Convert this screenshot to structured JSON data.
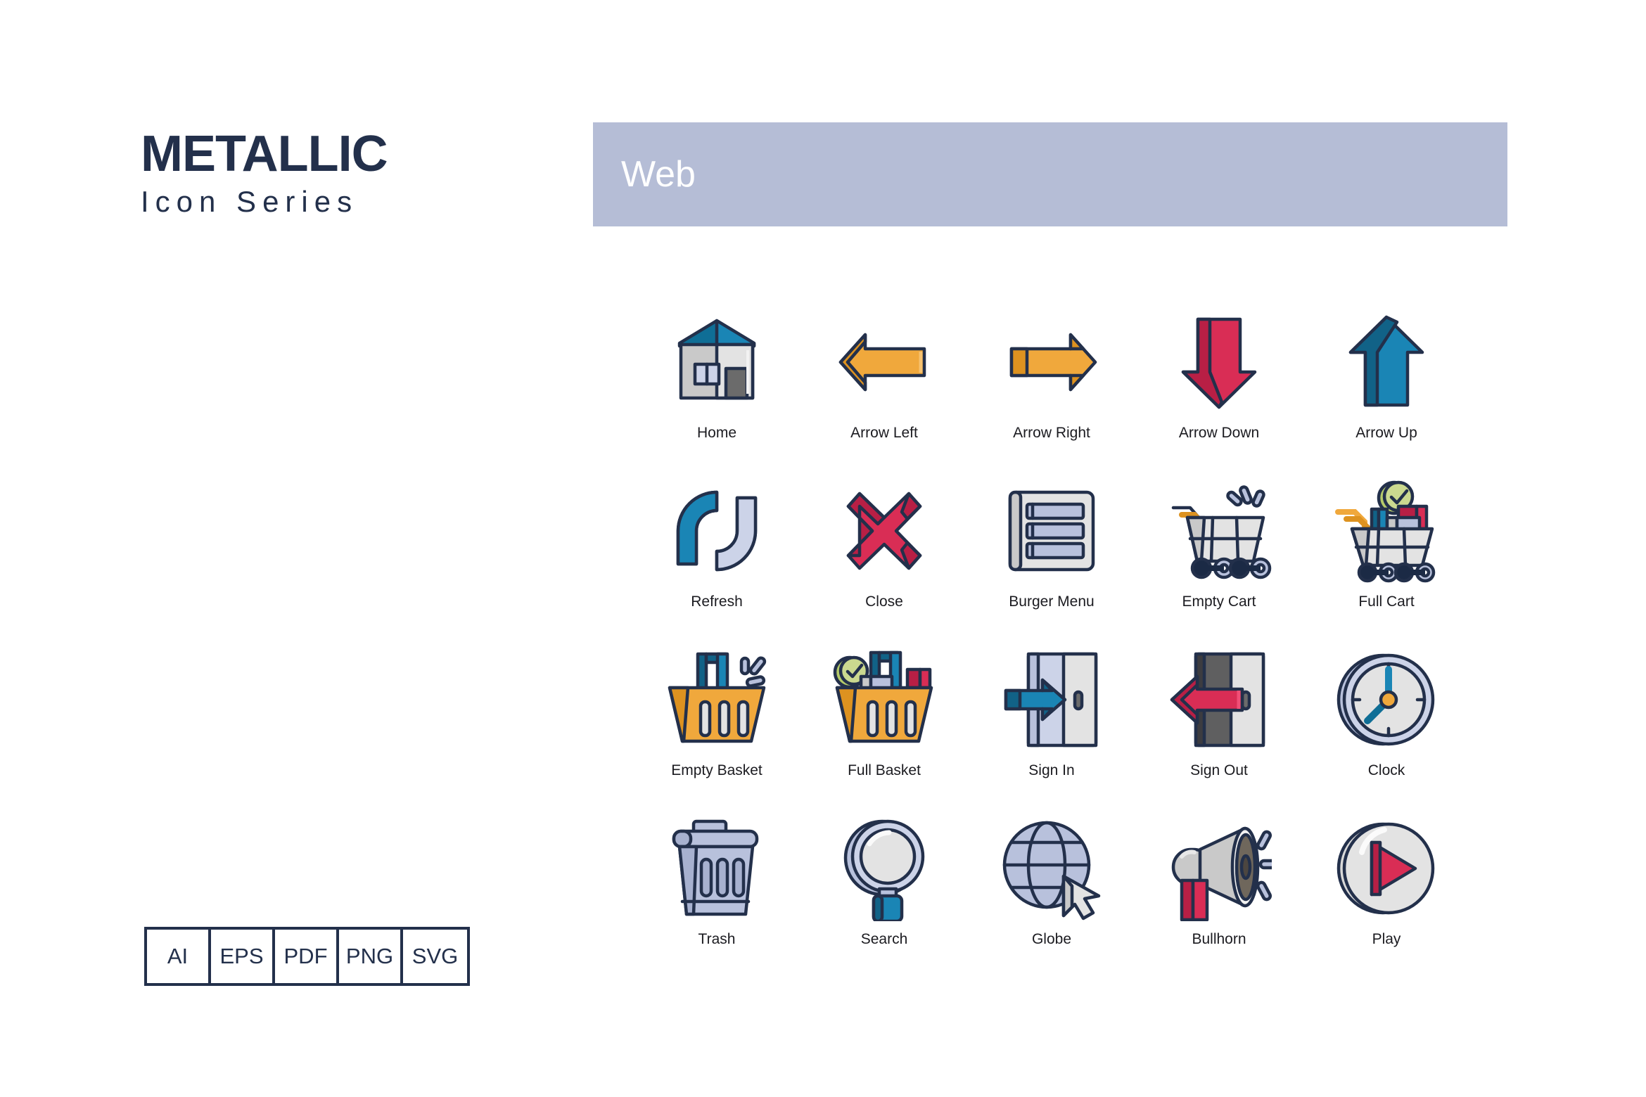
{
  "brand": {
    "title": "METALLIC",
    "subtitle": "Icon Series"
  },
  "category": {
    "label": "Web",
    "bar_color": "#b5bdd6",
    "text_color": "#ffffff"
  },
  "formats": {
    "items": [
      "AI",
      "EPS",
      "PDF",
      "PNG",
      "SVG"
    ]
  },
  "palette": {
    "outline": "#23304b",
    "navy": "#1b2a45",
    "blue": "#1a85b5",
    "blue_dark": "#0f6e96",
    "blue_deep": "#116287",
    "orange": "#f0a83c",
    "orange_dark": "#dd9220",
    "crimson": "#d92d55",
    "crimson_dark": "#b81f45",
    "lavender": "#b8c1dc",
    "lavender_light": "#ccd3e8",
    "gray_light": "#e3e3e3",
    "gray_mid": "#c9c9c9",
    "gray_dark": "#6b6b6b",
    "green": "#b5ca6a",
    "green_light": "#cbd98f"
  },
  "icons": [
    {
      "name": "home",
      "label": "Home"
    },
    {
      "name": "arrow-left",
      "label": "Arrow Left"
    },
    {
      "name": "arrow-right",
      "label": "Arrow Right"
    },
    {
      "name": "arrow-down",
      "label": "Arrow Down"
    },
    {
      "name": "arrow-up",
      "label": "Arrow Up"
    },
    {
      "name": "refresh",
      "label": "Refresh"
    },
    {
      "name": "close",
      "label": "Close"
    },
    {
      "name": "burger-menu",
      "label": "Burger Menu"
    },
    {
      "name": "empty-cart",
      "label": "Empty Cart"
    },
    {
      "name": "full-cart",
      "label": "Full Cart"
    },
    {
      "name": "empty-basket",
      "label": "Empty Basket"
    },
    {
      "name": "full-basket",
      "label": "Full Basket"
    },
    {
      "name": "sign-in",
      "label": "Sign In"
    },
    {
      "name": "sign-out",
      "label": "Sign Out"
    },
    {
      "name": "clock",
      "label": "Clock"
    },
    {
      "name": "trash",
      "label": "Trash"
    },
    {
      "name": "search",
      "label": "Search"
    },
    {
      "name": "globe",
      "label": "Globe"
    },
    {
      "name": "bullhorn",
      "label": "Bullhorn"
    },
    {
      "name": "play",
      "label": "Play"
    }
  ]
}
